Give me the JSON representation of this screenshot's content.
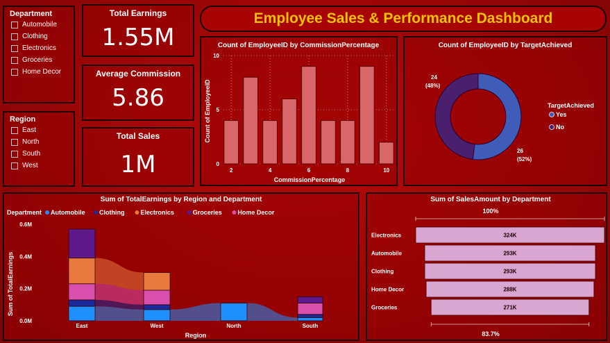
{
  "slicers": {
    "department": {
      "title": "Department",
      "items": [
        "Automobile",
        "Clothing",
        "Electronics",
        "Groceries",
        "Home Decor"
      ]
    },
    "region": {
      "title": "Region",
      "items": [
        "East",
        "North",
        "South",
        "West"
      ]
    }
  },
  "kpis": [
    {
      "title": "Total Earnings",
      "value": "1.55M"
    },
    {
      "title": "Average Commission",
      "value": "5.86"
    },
    {
      "title": "Total Sales",
      "value": "1M"
    }
  ],
  "header": {
    "title": "Employee Sales & Performance Dashboard"
  },
  "colors": {
    "bar": "#d9676a",
    "yes": "#3f5cb8",
    "no": "#4a1f6e",
    "funnel": "#d8a6d0",
    "title_gold": "#f2c200"
  },
  "chart_data": [
    {
      "type": "bar",
      "title": "Count of EmployeeID by CommissionPercentage",
      "xlabel": "CommissionPercentage",
      "ylabel": "Count of EmployeeID",
      "x": [
        2,
        3,
        4,
        5,
        6,
        7,
        8,
        9,
        10
      ],
      "values": [
        4,
        8,
        4,
        6,
        9,
        4,
        4,
        9,
        2
      ],
      "xticks": [
        "2",
        "4",
        "6",
        "8",
        "10"
      ],
      "yticks": [
        "0",
        "5",
        "10"
      ],
      "ylim": [
        0,
        10
      ]
    },
    {
      "type": "pie",
      "title": "Count of EmployeeID by TargetAchieved",
      "legend_title": "TargetAchieved",
      "slices": [
        {
          "name": "Yes",
          "value": 26,
          "label": "26",
          "pct": "(52%)"
        },
        {
          "name": "No",
          "value": 24,
          "label": "24",
          "pct": "(48%)"
        }
      ]
    },
    {
      "type": "bar",
      "title": "Sum of TotalEarnings by Region and Department",
      "xlabel": "Region",
      "ylabel": "Sum of TotalEarnings",
      "legend_title": "Department",
      "categories": [
        "East",
        "West",
        "North",
        "South"
      ],
      "yticks": [
        "0.0M",
        "0.2M",
        "0.4M",
        "0.6M"
      ],
      "ylim": [
        0,
        0.6
      ],
      "series": [
        {
          "name": "Automobile",
          "color": "#1e90ff",
          "values": [
            0.09,
            0.07,
            0.11,
            0.02
          ]
        },
        {
          "name": "Clothing",
          "color": "#1a2a9a",
          "values": [
            0.04,
            0.03,
            0.0,
            0.02
          ]
        },
        {
          "name": "Electronics",
          "color": "#e87a40",
          "values": [
            0.16,
            0.11,
            0.0,
            0.0
          ]
        },
        {
          "name": "Groceries",
          "color": "#5e1a8a",
          "values": [
            0.18,
            0.0,
            0.0,
            0.04
          ]
        },
        {
          "name": "Home Decor",
          "color": "#d94fae",
          "values": [
            0.1,
            0.09,
            0.0,
            0.07
          ]
        }
      ]
    },
    {
      "type": "bar",
      "title": "Sum of SalesAmount by Department",
      "categories": [
        "Electronics",
        "Automobile",
        "Clothing",
        "Home Decor",
        "Groceries"
      ],
      "values": [
        324,
        293,
        293,
        288,
        271
      ],
      "labels": [
        "324K",
        "293K",
        "293K",
        "288K",
        "271K"
      ],
      "top_label": "100%",
      "bottom_label": "83.7%"
    }
  ]
}
